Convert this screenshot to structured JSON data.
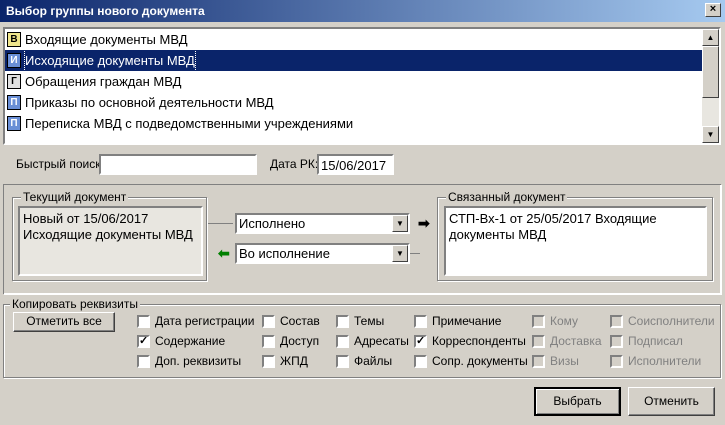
{
  "window": {
    "title": "Выбор группы нового документа",
    "close_glyph": "×"
  },
  "doc_groups": [
    {
      "label": "Входящие документы МВД",
      "icon": "В",
      "icon_style": "yellow",
      "selected": false
    },
    {
      "label": "Исходящие документы МВД",
      "icon": "И",
      "icon_style": "blue",
      "selected": true
    },
    {
      "label": "Обращения граждан МВД",
      "icon": "Г",
      "icon_style": "gray",
      "selected": false
    },
    {
      "label": "Приказы по основной деятельности МВД",
      "icon": "П",
      "icon_style": "blue",
      "selected": false
    },
    {
      "label": "Переписка МВД с подведомственными учреждениями",
      "icon": "П",
      "icon_style": "blue",
      "selected": false
    }
  ],
  "search": {
    "label": "Быстрый поиск:",
    "value": ""
  },
  "date_rk": {
    "label": "Дата РК:",
    "value": "15/06/2017"
  },
  "current_doc": {
    "legend": "Текущий документ",
    "text": "Новый от 15/06/2017\nИсходящие документы МВД"
  },
  "linked_doc": {
    "legend": "Связанный документ",
    "text": "СТП-Вх-1 от 25/05/2017 Входящие документы МВД"
  },
  "link_forward": {
    "value": "Исполнено"
  },
  "link_back": {
    "value": "Во исполнение"
  },
  "copy_props": {
    "legend": "Копировать реквизиты",
    "mark_all_label": "Отметить все",
    "items": [
      {
        "key": "reg_date",
        "label": "Дата регистрации",
        "checked": false,
        "enabled": true
      },
      {
        "key": "content",
        "label": "Содержание",
        "checked": true,
        "enabled": true
      },
      {
        "key": "extra_props",
        "label": "Доп. реквизиты",
        "checked": false,
        "enabled": true
      },
      {
        "key": "composition",
        "label": "Состав",
        "checked": false,
        "enabled": true
      },
      {
        "key": "access",
        "label": "Доступ",
        "checked": false,
        "enabled": true
      },
      {
        "key": "zhpd",
        "label": "ЖПД",
        "checked": false,
        "enabled": true
      },
      {
        "key": "topics",
        "label": "Темы",
        "checked": false,
        "enabled": true
      },
      {
        "key": "addressees",
        "label": "Адресаты",
        "checked": false,
        "enabled": true
      },
      {
        "key": "files",
        "label": "Файлы",
        "checked": false,
        "enabled": true
      },
      {
        "key": "note",
        "label": "Примечание",
        "checked": false,
        "enabled": true
      },
      {
        "key": "correspondents",
        "label": "Корреспонденты",
        "checked": true,
        "enabled": true
      },
      {
        "key": "accomp_docs",
        "label": "Сопр. документы",
        "checked": false,
        "enabled": true
      },
      {
        "key": "to_whom",
        "label": "Кому",
        "checked": false,
        "enabled": false
      },
      {
        "key": "delivery",
        "label": "Доставка",
        "checked": false,
        "enabled": false
      },
      {
        "key": "visas",
        "label": "Визы",
        "checked": false,
        "enabled": false
      },
      {
        "key": "co_executors",
        "label": "Соисполнители",
        "checked": false,
        "enabled": false
      },
      {
        "key": "signed",
        "label": "Подписал",
        "checked": false,
        "enabled": false
      },
      {
        "key": "executors",
        "label": "Исполнители",
        "checked": false,
        "enabled": false
      }
    ]
  },
  "actions": {
    "select_label": "Выбрать",
    "cancel_label": "Отменить"
  }
}
